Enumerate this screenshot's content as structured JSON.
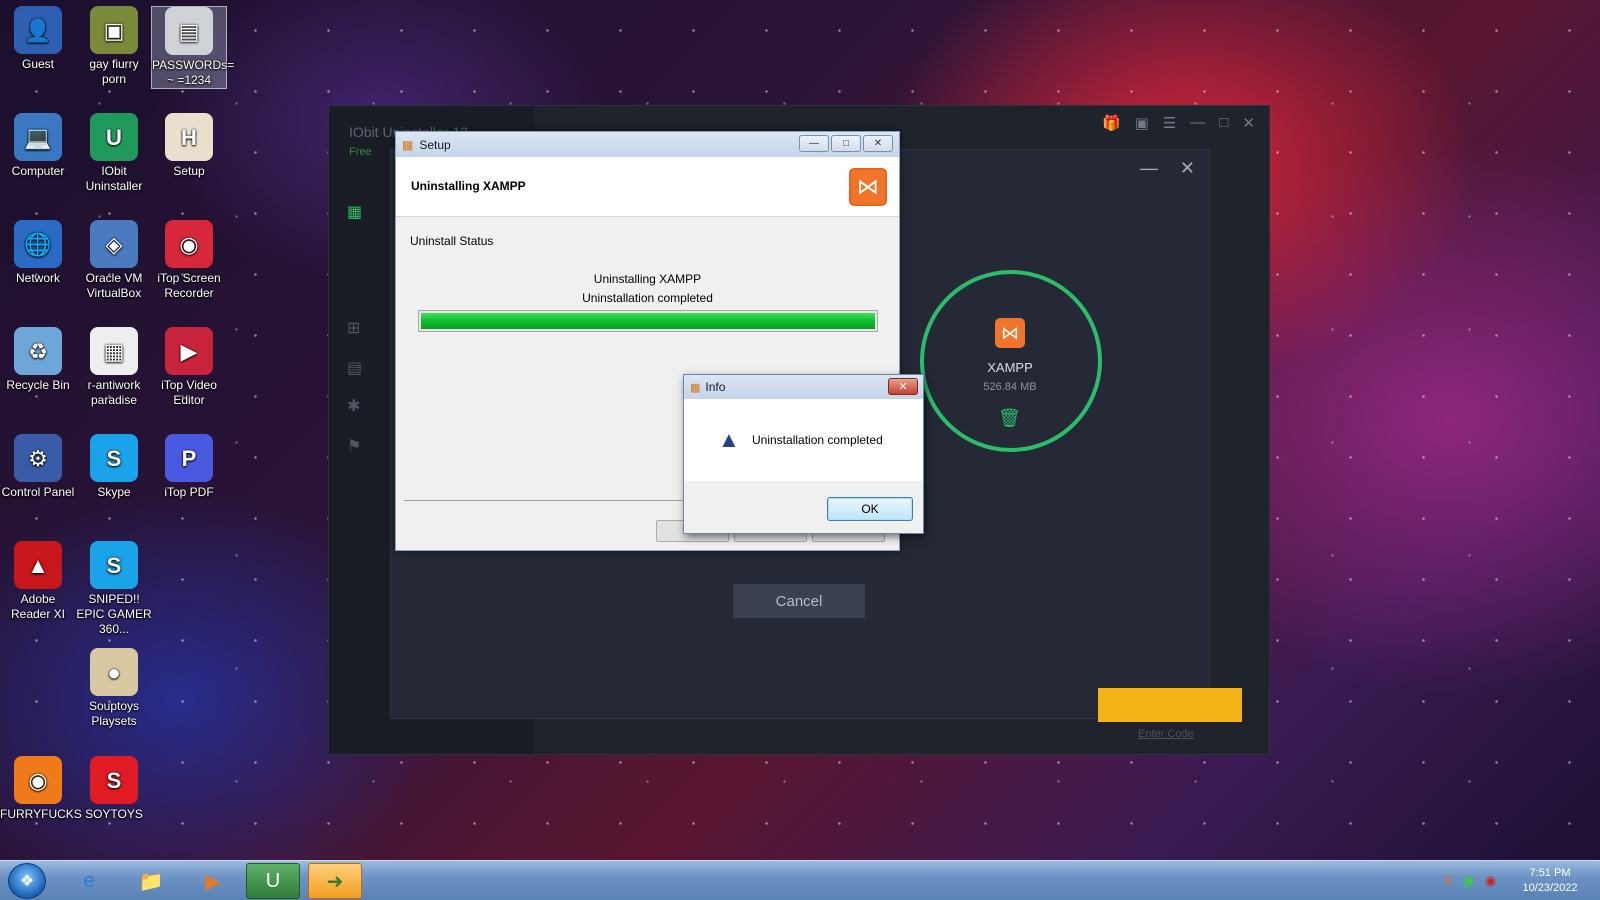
{
  "desktop": {
    "icons": [
      {
        "label": "Guest",
        "icon": "user-icon",
        "color": "#2f5fb0"
      },
      {
        "label": "gay fiurry porn",
        "icon": "box-icon",
        "color": "#7a8a3a"
      },
      {
        "label": "PASSWORDs= ~ =1234",
        "icon": "text-file-icon",
        "color": "#cfd3d8"
      },
      {
        "label": "Computer",
        "icon": "computer-icon",
        "color": "#3a78c4"
      },
      {
        "label": "IObit Uninstaller",
        "icon": "iobit-uninstaller-icon",
        "color": "#1f9a5a"
      },
      {
        "label": "Setup",
        "icon": "setup-icon",
        "color": "#e8e0cc"
      },
      {
        "label": "Network",
        "icon": "network-icon",
        "color": "#2b6bc4"
      },
      {
        "label": "Oracle VM VirtualBox",
        "icon": "virtualbox-icon",
        "color": "#4a7ac0"
      },
      {
        "label": "iTop Screen Recorder",
        "icon": "screen-recorder-icon",
        "color": "#d6283a"
      },
      {
        "label": "Recycle Bin",
        "icon": "recycle-bin-icon",
        "color": "#6fa6d8"
      },
      {
        "label": "r-antiwork paradise",
        "icon": "document-icon",
        "color": "#eeeeee"
      },
      {
        "label": "iTop Video Editor",
        "icon": "video-editor-icon",
        "color": "#c8243e"
      },
      {
        "label": "Control Panel",
        "icon": "control-panel-icon",
        "color": "#3a5ca8"
      },
      {
        "label": "Skype",
        "icon": "skype-icon",
        "color": "#1aa3e8"
      },
      {
        "label": "iTop PDF",
        "icon": "pdf-icon",
        "color": "#4a5ae0"
      },
      {
        "label": "Adobe Reader XI",
        "icon": "adobe-reader-icon",
        "color": "#c8161d"
      },
      {
        "label": "SNIPED!! EPIC GAMER 360...",
        "icon": "skype-icon",
        "color": "#1aa3e8"
      },
      {
        "label": "Souptoys Playsets",
        "icon": "souptoys-icon",
        "color": "#d9c9a2"
      },
      {
        "label": "FURRYFUCKS",
        "icon": "firefox-icon",
        "color": "#f07a1a"
      },
      {
        "label": "SOYTOYS",
        "icon": "soytoys-icon",
        "color": "#e01b24"
      }
    ]
  },
  "iobit": {
    "title": "IObit Uninstaller 12",
    "subtitle": "Free",
    "app_name": "XAMPP",
    "app_size": "526.84 MB",
    "cancel_label": "Cancel",
    "enter_code": "Enter Code",
    "accent_color": "#2bbd6b"
  },
  "setup": {
    "window_title": "Setup",
    "header_title": "Uninstalling XAMPP",
    "status_label": "Uninstall Status",
    "status_line1": "Uninstalling XAMPP",
    "status_line2": "Uninstallation completed",
    "progress": 1.0,
    "nav_buttons": [
      "<",
      "",
      ""
    ]
  },
  "info_dialog": {
    "title": "Info",
    "message": "Uninstallation completed",
    "ok_label": "OK"
  },
  "taskbar": {
    "time": "7:51 PM",
    "date": "10/23/2022"
  }
}
